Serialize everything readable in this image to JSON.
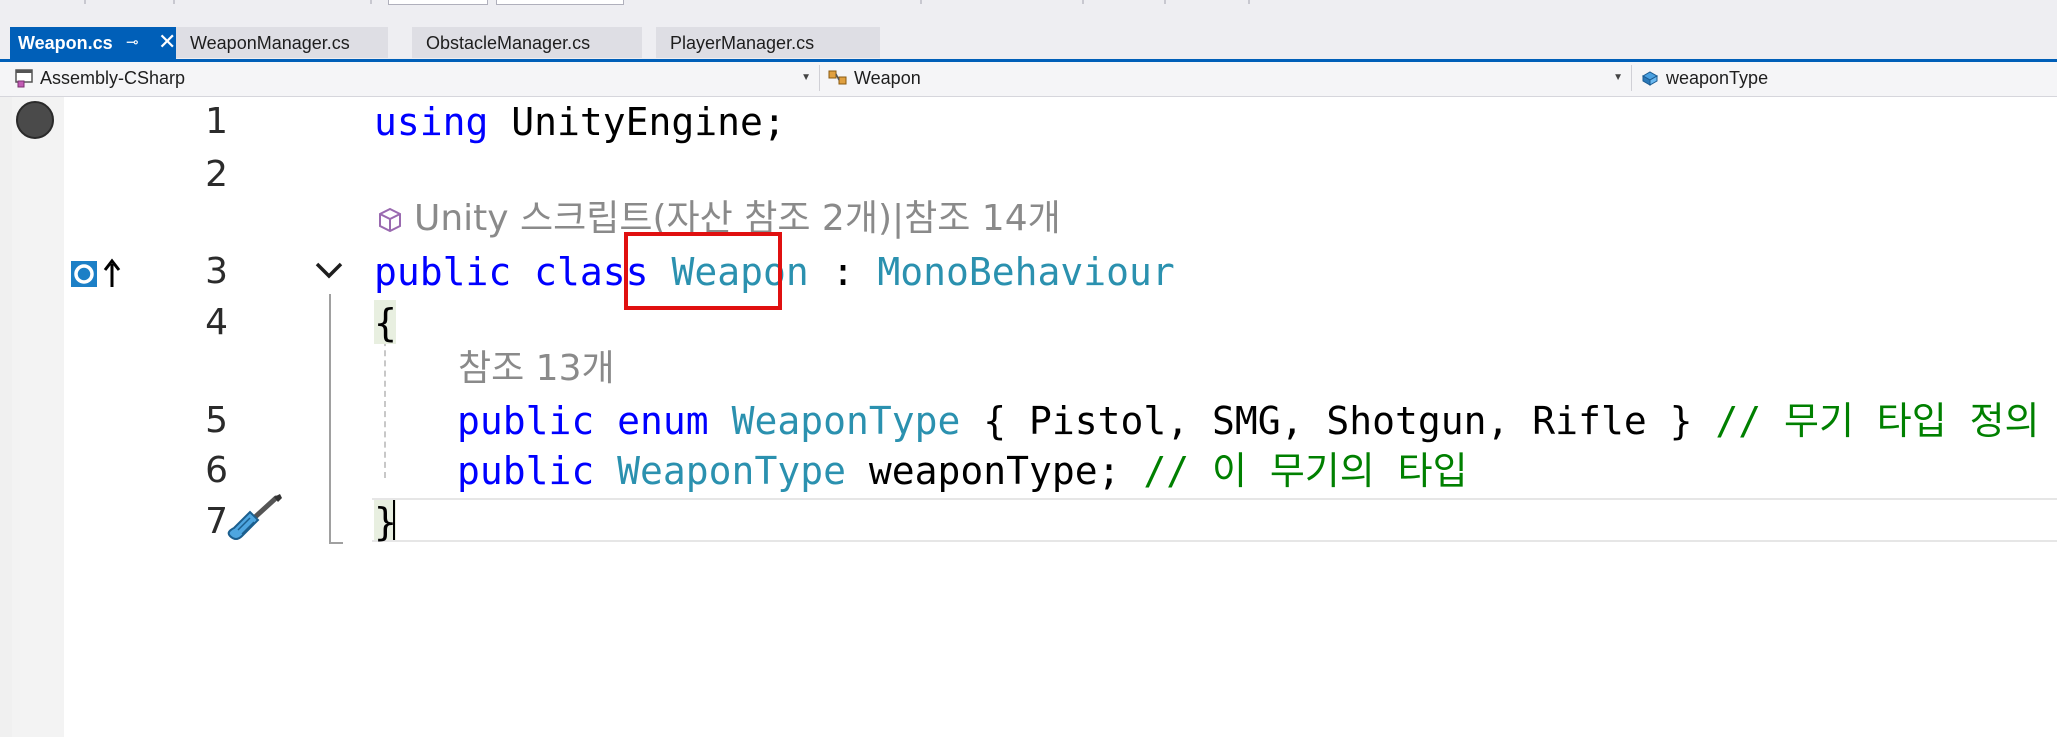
{
  "tabs": [
    {
      "label": "Weapon.cs",
      "active": true,
      "pin_glyph": "⊸",
      "close_glyph": "✕"
    },
    {
      "label": "WeaponManager.cs",
      "active": false
    },
    {
      "label": "ObstacleManager.cs",
      "active": false
    },
    {
      "label": "PlayerManager.cs",
      "active": false
    }
  ],
  "navbar": {
    "project": "Assembly-CSharp",
    "type": "Weapon",
    "member": "weaponType",
    "arrow_glyph": "▼"
  },
  "editor": {
    "line_numbers": [
      "1",
      "2",
      "3",
      "4",
      "5",
      "6",
      "7"
    ],
    "codelens_class": "Unity 스크립트(자산 참조 2개)|참조 14개",
    "codelens_enum": "참조 13개",
    "line1": {
      "kw": "using",
      "rest": " UnityEngine;"
    },
    "line3": {
      "kw1": "public",
      "kw2": "class",
      "name": "Weapon",
      "colon": " : ",
      "base": "MonoBehaviour"
    },
    "line4": "{",
    "line5": {
      "kw1": "public",
      "kw2": "enum",
      "name": "WeaponType",
      "rest": " { Pistol, SMG, Shotgun, Rifle } ",
      "comment": "// 무기 타입 정의"
    },
    "line6": {
      "kw": "public",
      "type": "WeaponType",
      "rest": " weaponType; ",
      "comment": "// 이 무기의 타입"
    },
    "line7": "}"
  },
  "colors": {
    "keyword": "#0000ff",
    "type": "#2b91af",
    "comment": "#008000",
    "accent": "#005fb8",
    "highlight_box": "#e01010"
  },
  "icons": [
    "breakpoint-icon",
    "cube-icon",
    "class-goto-base-icon",
    "chevron-down-icon",
    "screwdriver-icon"
  ]
}
